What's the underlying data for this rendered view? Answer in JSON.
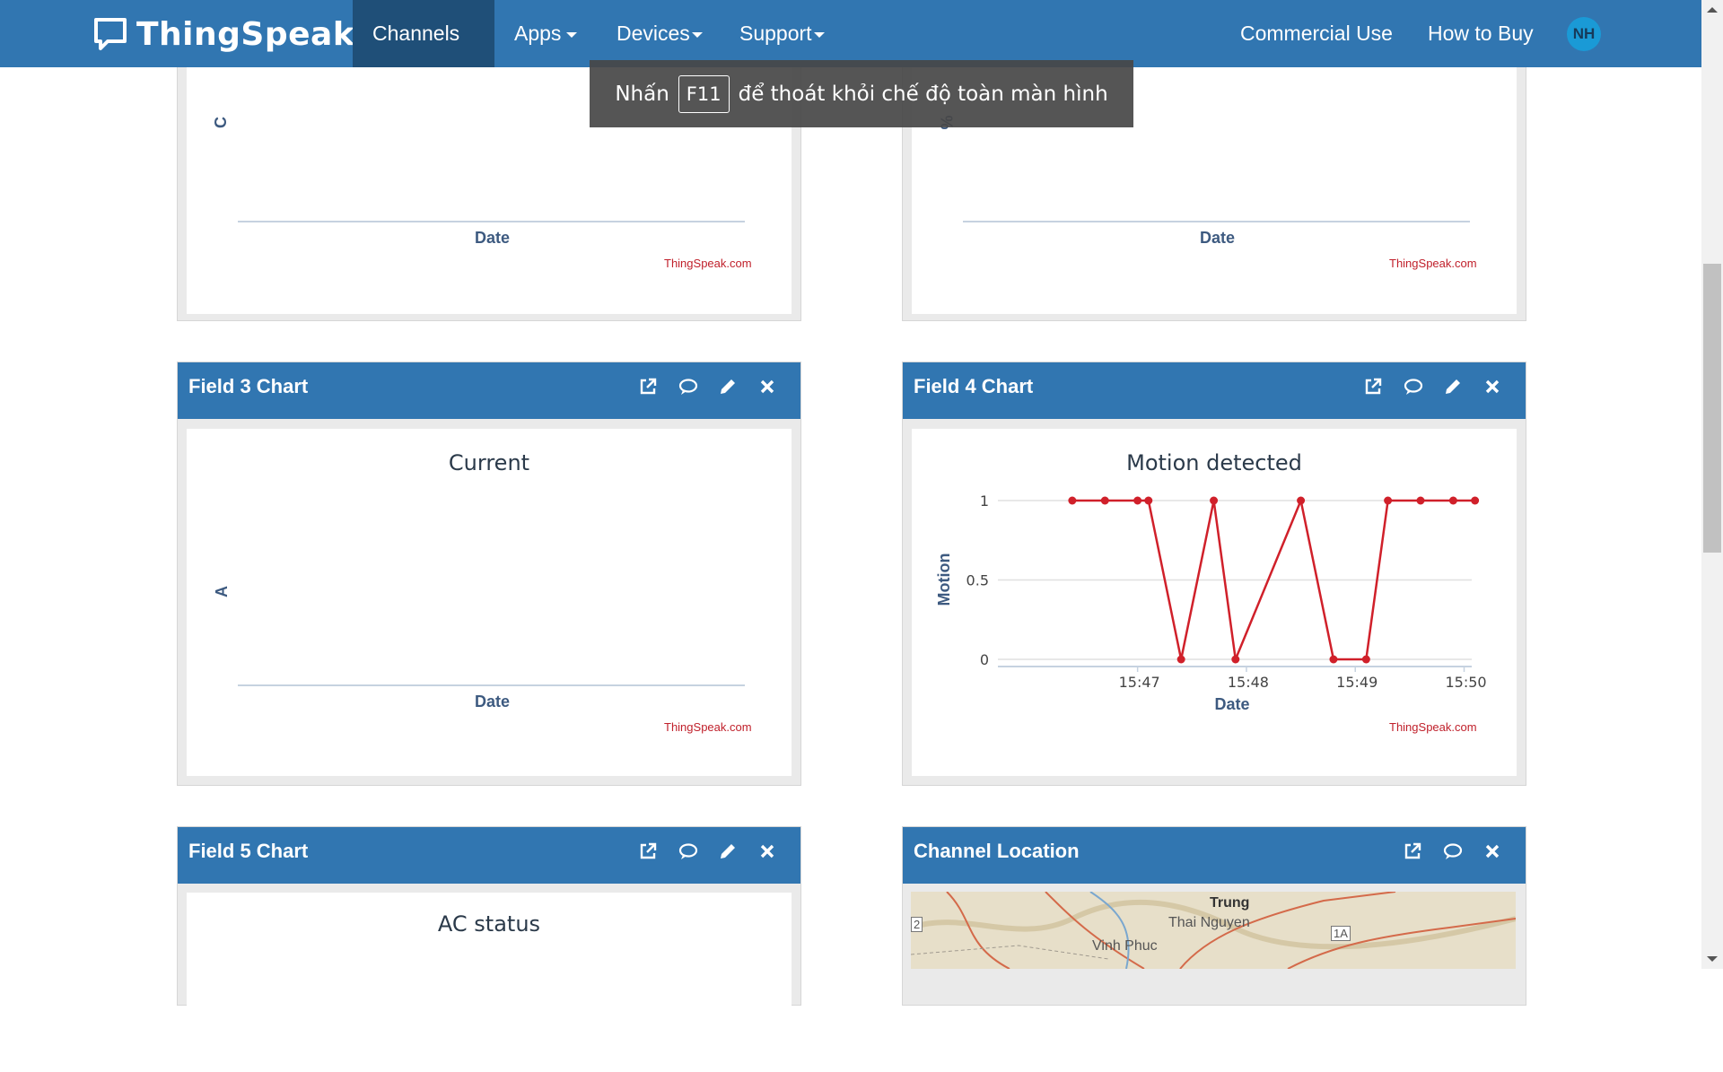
{
  "navbar": {
    "brand": "ThingSpeak",
    "brand_tm": "™",
    "items": [
      {
        "label": "Channels",
        "has_caret": true,
        "active": true
      },
      {
        "label": "Apps",
        "has_caret": true
      },
      {
        "label": "Devices",
        "has_caret": true
      },
      {
        "label": "Support",
        "has_caret": true
      }
    ],
    "right_items": [
      "Commercial Use",
      "How to Buy"
    ],
    "avatar_initials": "NH"
  },
  "fullscreen_toast": {
    "before": "Nhấn",
    "key": "F11",
    "after": "để thoát khỏi chế độ toàn màn hình"
  },
  "panels": {
    "field1": {
      "ylabel": "C",
      "xlabel": "Date",
      "credit": "ThingSpeak.com"
    },
    "field2": {
      "ylabel": "%",
      "xlabel": "Date",
      "credit": "ThingSpeak.com"
    },
    "field3": {
      "title": "Field 3 Chart",
      "chart_title": "Current",
      "ylabel": "A",
      "xlabel": "Date",
      "credit": "ThingSpeak.com"
    },
    "field4": {
      "title": "Field 4 Chart",
      "credit": "ThingSpeak.com"
    },
    "field5": {
      "title": "Field 5 Chart",
      "chart_title": "AC status"
    },
    "location": {
      "title": "Channel Location",
      "map_labels": [
        "Trung",
        "Thai Nguyen",
        "Vinh Phuc",
        "1A",
        "2"
      ]
    }
  },
  "chart_data": [
    {
      "type": "line",
      "title": "",
      "xlabel": "Date",
      "ylabel": "C",
      "series": []
    },
    {
      "type": "line",
      "title": "",
      "xlabel": "Date",
      "ylabel": "%",
      "series": []
    },
    {
      "type": "line",
      "title": "Current",
      "xlabel": "Date",
      "ylabel": "A",
      "series": []
    },
    {
      "type": "line",
      "title": "Motion detected",
      "xlabel": "Date",
      "ylabel": "Motion",
      "ylim": [
        0,
        1
      ],
      "yticks": [
        0,
        0.5,
        1
      ],
      "xticks": [
        "15:47",
        "15:48",
        "15:49",
        "15:50"
      ],
      "xlim_minutes": [
        15.7167,
        50.07
      ],
      "series": [
        {
          "color": "#d0202a",
          "points": [
            {
              "x": "15:46.4",
              "y": 1
            },
            {
              "x": "15:46.7",
              "y": 1
            },
            {
              "x": "15:47.0",
              "y": 1
            },
            {
              "x": "15:47.1",
              "y": 1
            },
            {
              "x": "15:47.4",
              "y": 0
            },
            {
              "x": "15:47.7",
              "y": 1
            },
            {
              "x": "15:47.9",
              "y": 0
            },
            {
              "x": "15:48.5",
              "y": 1
            },
            {
              "x": "15:48.8",
              "y": 0
            },
            {
              "x": "15:49.1",
              "y": 0
            },
            {
              "x": "15:49.3",
              "y": 1
            },
            {
              "x": "15:49.6",
              "y": 1
            },
            {
              "x": "15:49.9",
              "y": 1
            },
            {
              "x": "15:50.1",
              "y": 1
            }
          ]
        }
      ],
      "grid": true,
      "legend": "none"
    },
    {
      "type": "line",
      "title": "AC status",
      "series": []
    }
  ],
  "colors": {
    "navbar": "#3176b1",
    "navbar_active": "#1f4f78",
    "line": "#d0202a",
    "credit": "#c0202b",
    "axis_label": "#3d5a80"
  }
}
